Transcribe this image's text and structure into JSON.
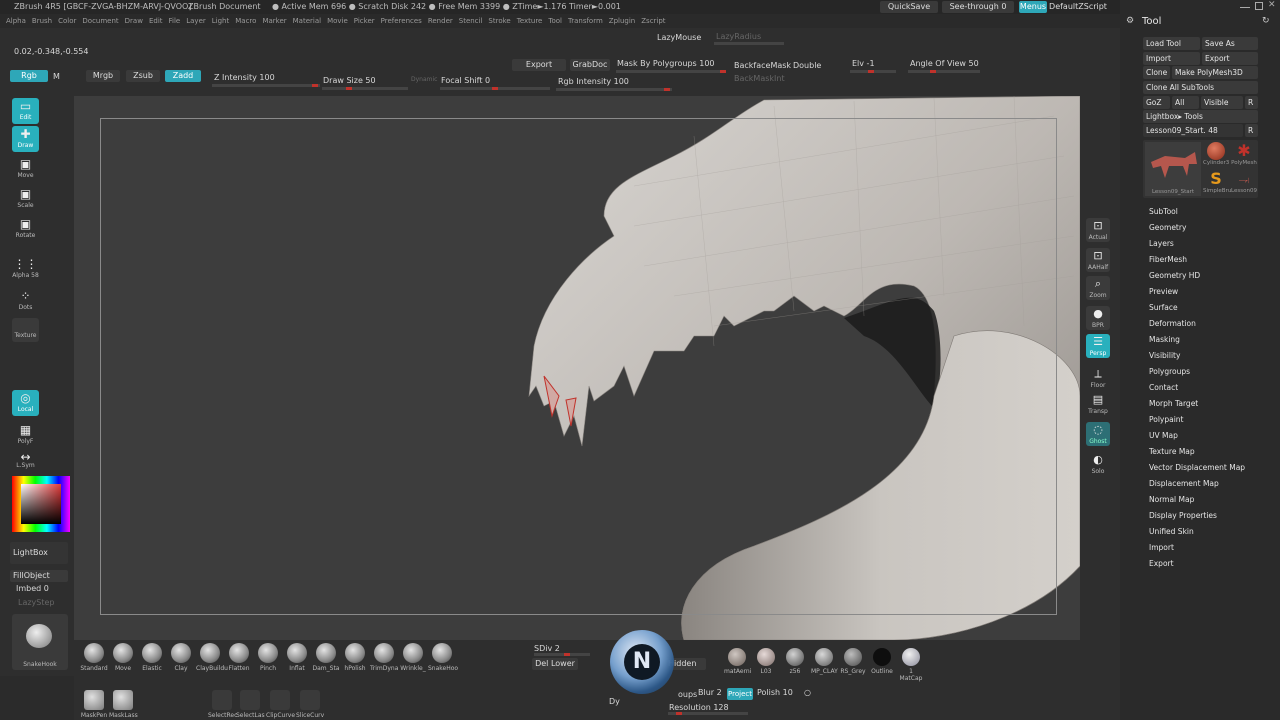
{
  "titlebar": {
    "app": "ZBrush 4R5 [GBCF-ZVGA-BHZM-ARVJ-QVOO]",
    "document": "ZBrush Document",
    "stats": "● Active Mem 696  ● Scratch Disk 242  ● Free Mem 3399  ● ZTime►1.176  Timer►0.001",
    "quicksave": "QuickSave",
    "seethrough": "See-through  0",
    "menus": "Menus",
    "defaultzscript": "DefaultZScript"
  },
  "menubar": [
    "Alpha",
    "Brush",
    "Color",
    "Document",
    "Draw",
    "Edit",
    "File",
    "Layer",
    "Light",
    "Macro",
    "Marker",
    "Material",
    "Movie",
    "Picker",
    "Preferences",
    "Render",
    "Stencil",
    "Stroke",
    "Texture",
    "Tool",
    "Transform",
    "Zplugin",
    "Zscript"
  ],
  "toolbar": {
    "coords": "0.02,-0.348,-0.554",
    "lazymouse": "LazyMouse",
    "lazyradius": "LazyRadius",
    "export": "Export",
    "grabdoc": "GrabDoc",
    "mask_by_polygroups": "Mask By Polygroups 100",
    "backfacemask": "BackfaceMask",
    "double": "Double",
    "backmaskint": "BackMaskInt",
    "elv": "Elv -1",
    "angle_of_view": "Angle Of View 50",
    "rgb": "Rgb",
    "m": "M",
    "mrgb": "Mrgb",
    "zsub": "Zsub",
    "zadd": "Zadd",
    "z_intensity": "Z Intensity 100",
    "draw_size": "Draw Size 50",
    "dynamic": "Dynamic",
    "focal_shift": "Focal Shift 0",
    "rgb_intensity": "Rgb Intensity 100"
  },
  "leftshelf": {
    "edit": "Edit",
    "draw": "Draw",
    "move": "Move",
    "scale": "Scale",
    "rotate": "Rotate",
    "alpha": "Alpha 58",
    "dots": "Dots",
    "texture": "Texture",
    "local": "Local",
    "polyf": "PolyF",
    "lsym": "L.Sym",
    "lightbox": "LightBox",
    "fillobject": "FillObject",
    "imbed": "Imbed 0",
    "lazystep": "LazyStep",
    "brush_name": "SnakeHook"
  },
  "rightshelf": [
    "Actual",
    "AAHalf",
    "Zoom",
    "BPR",
    "Persp",
    "Floor",
    "Transp",
    "Ghost",
    "Solo"
  ],
  "bottom": {
    "brushes": [
      "Standard",
      "Move",
      "Elastic",
      "Clay",
      "ClayBuildu",
      "Flatten",
      "Pinch",
      "Inflat",
      "Dam_Sta",
      "hPolish",
      "TrimDyna",
      "Wrinkle_",
      "SnakeHoo"
    ],
    "sdiv": "SDiv 2",
    "del_lower": "Del Lower",
    "hidden": "Hidden",
    "materials": [
      "matAerni",
      "L03",
      "z56",
      "MP_CLAY",
      "RS_Grey",
      "Outline",
      "1 MatCap"
    ],
    "tools": [
      "MaskPen",
      "MaskLass",
      "SelectRec",
      "SelectLas",
      "ClipCurve",
      "SliceCurv"
    ],
    "groups": "oups",
    "blur": "Blur 2",
    "project": "Project",
    "polish": "Polish 10",
    "resolution": "Resolution 128",
    "dy": "Dy"
  },
  "tray": {
    "title": "Tool",
    "load_tool": "Load Tool",
    "save_as": "Save As",
    "import": "Import",
    "export": "Export",
    "clone": "Clone",
    "make_polymesh": "Make PolyMesh3D",
    "clone_all": "Clone  All SubTools",
    "goz": "GoZ",
    "all": "All",
    "visible": "Visible",
    "r": "R",
    "lightbox_tools": "Lightbox▸ Tools",
    "current_tool": "Lesson09_Start. 48",
    "thumbs": [
      "Lesson09_Start",
      "Cylinder3",
      "PolyMesh",
      "SimpleBru",
      "Lesson09"
    ],
    "panels": [
      "SubTool",
      "Geometry",
      "Layers",
      "FiberMesh",
      "Geometry HD",
      "Preview",
      "Surface",
      "Deformation",
      "Masking",
      "Visibility",
      "Polygroups",
      "Contact",
      "Morph Target",
      "Polypaint",
      "UV Map",
      "Texture Map",
      "Vector Displacement Map",
      "Displacement Map",
      "Normal Map",
      "Display Properties",
      "Unified Skin",
      "Import",
      "Export"
    ]
  },
  "colors": {
    "accent": "#2ea7b8",
    "slider": "#c0322b",
    "viewport": "#3d3d3d"
  }
}
